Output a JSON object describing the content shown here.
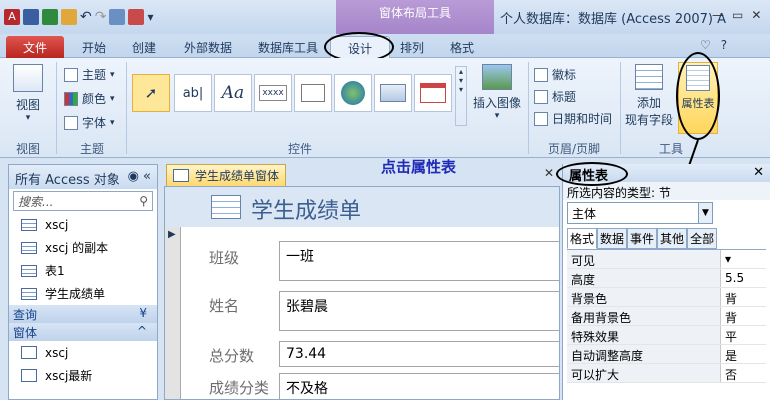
{
  "titlebar": {
    "app_icon": "A",
    "context_group": "窗体布局工具",
    "title": "个人数据库：数据库 (Access 2007) A"
  },
  "window_controls": {
    "minimize": "—",
    "maximize": "▭",
    "close": "✕"
  },
  "tabs": [
    "文件",
    "开始",
    "创建",
    "外部数据",
    "数据库工具",
    "设计",
    "排列",
    "格式"
  ],
  "help_controls": {
    "collapse": "♡",
    "help": "?"
  },
  "ribbon": {
    "view": {
      "label": "视图",
      "group": "视图"
    },
    "theme": {
      "items": [
        "主题",
        "颜色",
        "字体"
      ],
      "group": "主题"
    },
    "controls": {
      "group": "控件",
      "items": [
        "ab|",
        "Aa",
        "xxxx"
      ]
    },
    "insert_image": {
      "label": "插入图像"
    },
    "header_footer": {
      "items": [
        "徽标",
        "标题",
        "日期和时间"
      ],
      "group": "页眉/页脚"
    },
    "tools": {
      "add_field_line1": "添加",
      "add_field_line2": "现有字段",
      "property_sheet": "属性表",
      "group": "工具"
    }
  },
  "nav": {
    "header": "所有 Access 对象",
    "search_placeholder": "搜索...",
    "tables": [
      "xscj",
      "xscj 的副本",
      "表1",
      "学生成绩单"
    ],
    "groups": {
      "query": "查询",
      "form": "窗体"
    },
    "forms": [
      "xscj",
      "xscj最新"
    ]
  },
  "doc_tab": "学生成绩单窗体",
  "annotation": "点击属性表",
  "form": {
    "title": "学生成绩单",
    "fields": [
      {
        "label": "班级",
        "value": "一班"
      },
      {
        "label": "姓名",
        "value": "张碧晨"
      },
      {
        "label": "总分数",
        "value": "73.44"
      },
      {
        "label": "成绩分类",
        "value": "不及格"
      }
    ]
  },
  "props": {
    "title": "属性表",
    "selection_type": "所选内容的类型: 节",
    "selected": "主体",
    "tabs": [
      "格式",
      "数据",
      "事件",
      "其他",
      "全部"
    ],
    "rows": [
      {
        "name": "可见",
        "value": ""
      },
      {
        "name": "高度",
        "value": "5.5"
      },
      {
        "name": "背景色",
        "value": "背"
      },
      {
        "name": "备用背景色",
        "value": "背"
      },
      {
        "name": "特殊效果",
        "value": "平"
      },
      {
        "name": "自动调整高度",
        "value": "是"
      },
      {
        "name": "可以扩大",
        "value": "否"
      }
    ]
  }
}
